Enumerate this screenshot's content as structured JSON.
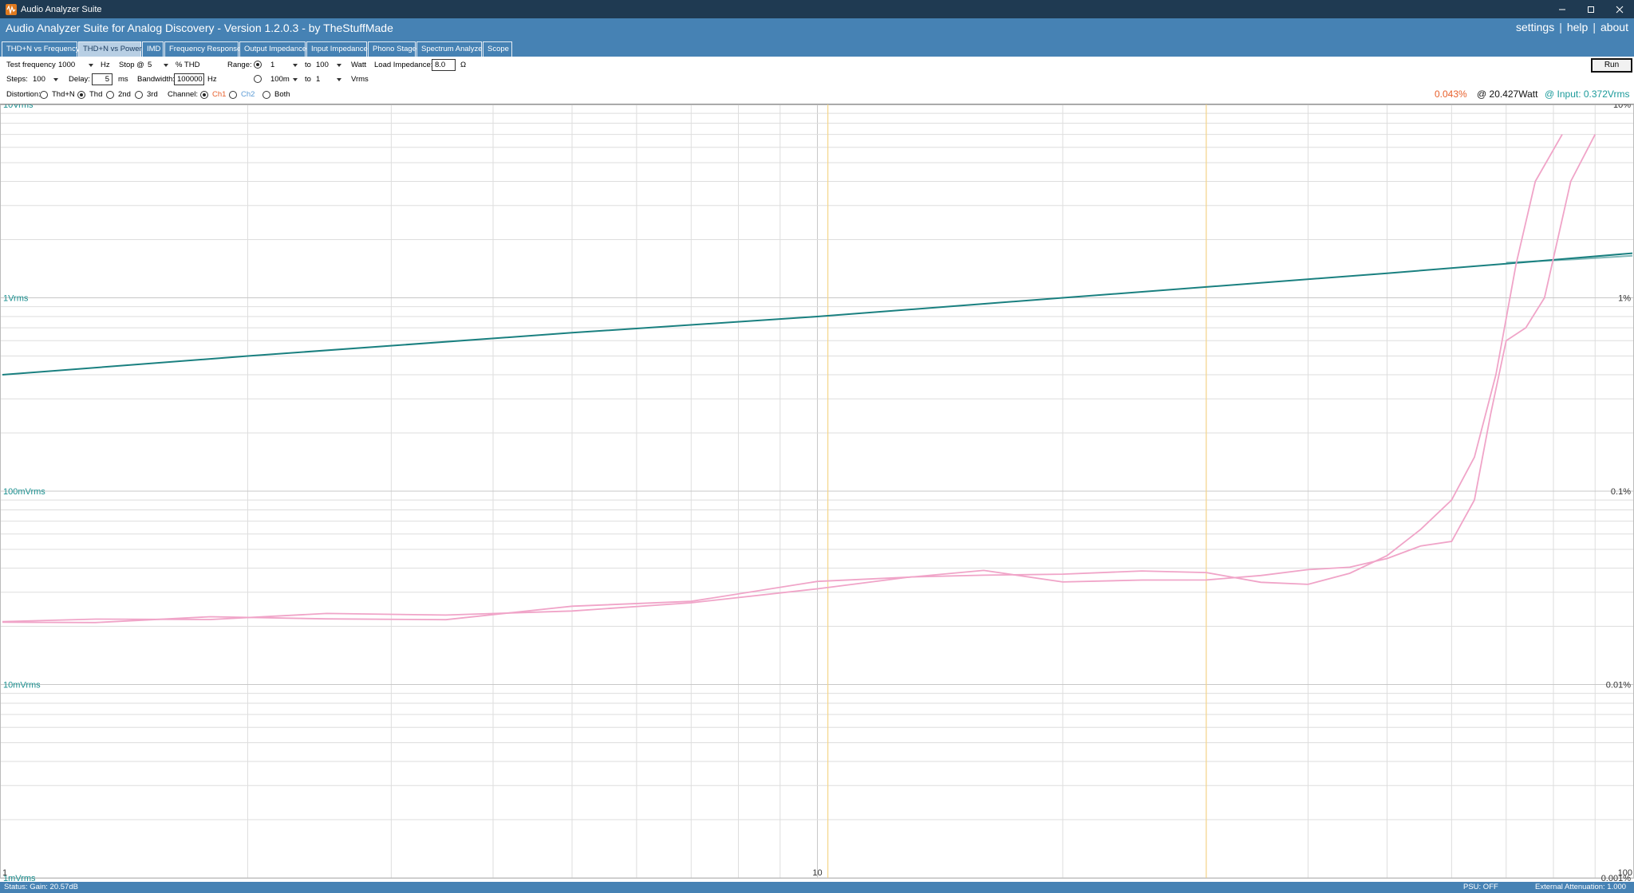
{
  "window": {
    "title": "Audio Analyzer Suite"
  },
  "header": {
    "heading": "Audio Analyzer Suite for Analog Discovery - Version   1.2.0.3   - by TheStuffMade",
    "links": [
      "settings",
      "help",
      "about"
    ]
  },
  "tabs": [
    {
      "label": "THD+N vs Frequency",
      "active": false
    },
    {
      "label": "THD+N vs Power",
      "active": true
    },
    {
      "label": "IMD",
      "active": false
    },
    {
      "label": "Frequency Response",
      "active": false
    },
    {
      "label": "Output Impedance",
      "active": false
    },
    {
      "label": "Input Impedance",
      "active": false
    },
    {
      "label": "Phono Stage",
      "active": false
    },
    {
      "label": "Spectrum Analyzer",
      "active": false
    },
    {
      "label": "Scope",
      "active": false
    }
  ],
  "controls": {
    "test_frequency_label": "Test frequency:",
    "test_frequency_value": "1000",
    "hz_unit": "Hz",
    "stop_label": "Stop @",
    "stop_value": "5",
    "thd_unit": "% THD",
    "range_label": "Range:",
    "range_watt_from": "1",
    "to_label": "to",
    "range_watt_to": "100",
    "watt_unit": "Watt",
    "load_impedance_label": "Load Impedance:",
    "load_impedance_value": "8.0",
    "ohm_unit": "Ω",
    "steps_label": "Steps:",
    "steps_value": "100",
    "delay_label": "Delay:",
    "delay_value": "5",
    "ms_unit": "ms",
    "bandwidth_label": "Bandwidth:",
    "bandwidth_value": "100000",
    "range_vrms_from": "100m",
    "range_vrms_to": "1",
    "vrms_unit": "Vrms",
    "distortion_label": "Distortion:",
    "distortion_options": [
      "Thd+N",
      "Thd",
      "2nd",
      "3rd"
    ],
    "distortion_selected": "Thd",
    "channel_label": "Channel:",
    "channel_options": [
      "Ch1",
      "Ch2",
      "Both"
    ],
    "channel_selected": "Ch1",
    "run_label": "Run"
  },
  "readout": {
    "thd": "0.043%",
    "power": "@ 20.427Watt",
    "input": "@ Input: 0.372Vrms"
  },
  "colors": {
    "titlebar": "#1f3a52",
    "header": "#4682b4",
    "thd_trace": "#f0a4c8",
    "voltage_trace": "#1a8080",
    "ch1": "#e8602c",
    "ch2": "#5b9bd5",
    "marker": "#f5d58a"
  },
  "chart_data": {
    "type": "line",
    "x_scale": "log",
    "xlim": [
      1,
      100
    ],
    "left_axis": {
      "scale": "log",
      "ticks": [
        "10Vrms",
        "1Vrms",
        "100mVrms",
        "10mVrms",
        "1mVrms"
      ],
      "range": [
        0.001,
        10
      ]
    },
    "right_axis": {
      "scale": "log",
      "ticks": [
        "10%",
        "1%",
        "0.1%",
        "0.01%",
        "0.001%"
      ],
      "range": [
        0.001,
        10
      ]
    },
    "x_tick_labels": [
      "1",
      "10",
      "100"
    ],
    "series": [
      {
        "axis": "left",
        "points": [
          [
            1.0,
            0.4
          ],
          [
            2.0,
            0.5
          ],
          [
            5.0,
            0.66
          ],
          [
            10.0,
            0.8
          ],
          [
            20.0,
            1.0
          ],
          [
            50.0,
            1.34
          ],
          [
            70.0,
            1.5
          ],
          [
            100.0,
            1.7
          ]
        ]
      },
      {
        "axis": "left",
        "points": [
          [
            70.0,
            1.52
          ],
          [
            85.0,
            1.58
          ],
          [
            100.0,
            1.65
          ]
        ]
      },
      {
        "axis": "right",
        "points": [
          [
            1.0,
            0.021
          ],
          [
            1.3,
            0.023
          ],
          [
            1.8,
            0.021
          ],
          [
            2.5,
            0.022
          ],
          [
            3.5,
            0.022
          ],
          [
            5.0,
            0.023
          ],
          [
            7.0,
            0.026
          ],
          [
            10.0,
            0.032
          ],
          [
            13.0,
            0.035
          ],
          [
            16.0,
            0.038
          ],
          [
            20.0,
            0.038
          ],
          [
            25.0,
            0.037
          ],
          [
            30.0,
            0.036
          ],
          [
            35.0,
            0.034
          ],
          [
            40.0,
            0.035
          ],
          [
            45.0,
            0.039
          ],
          [
            50.0,
            0.045
          ],
          [
            55.0,
            0.06
          ],
          [
            60.0,
            0.09
          ],
          [
            64.0,
            0.15
          ],
          [
            68.0,
            0.4
          ],
          [
            72.0,
            1.5
          ],
          [
            76.0,
            4.0
          ],
          [
            82.0,
            7.0
          ]
        ]
      },
      {
        "axis": "right",
        "points": [
          [
            1.0,
            0.022
          ],
          [
            1.3,
            0.021
          ],
          [
            1.8,
            0.023
          ],
          [
            2.5,
            0.021
          ],
          [
            3.5,
            0.022
          ],
          [
            5.0,
            0.024
          ],
          [
            7.0,
            0.028
          ],
          [
            10.0,
            0.033
          ],
          [
            13.0,
            0.037
          ],
          [
            16.0,
            0.038
          ],
          [
            20.0,
            0.036
          ],
          [
            25.0,
            0.035
          ],
          [
            30.0,
            0.033
          ],
          [
            35.0,
            0.035
          ],
          [
            40.0,
            0.04
          ],
          [
            45.0,
            0.043
          ],
          [
            50.0,
            0.046
          ],
          [
            55.0,
            0.05
          ],
          [
            60.0,
            0.055
          ],
          [
            64.0,
            0.09
          ],
          [
            67.0,
            0.25
          ],
          [
            70.0,
            0.6
          ],
          [
            74.0,
            0.7
          ],
          [
            78.0,
            1.0
          ],
          [
            84.0,
            4.0
          ],
          [
            90.0,
            7.0
          ]
        ]
      }
    ],
    "markers_x": [
      10.3,
      30.0
    ]
  },
  "status": {
    "left": "Status: Gain: 20.57dB",
    "psu": "PSU: OFF",
    "ext": "External Attenuation: 1.000"
  }
}
